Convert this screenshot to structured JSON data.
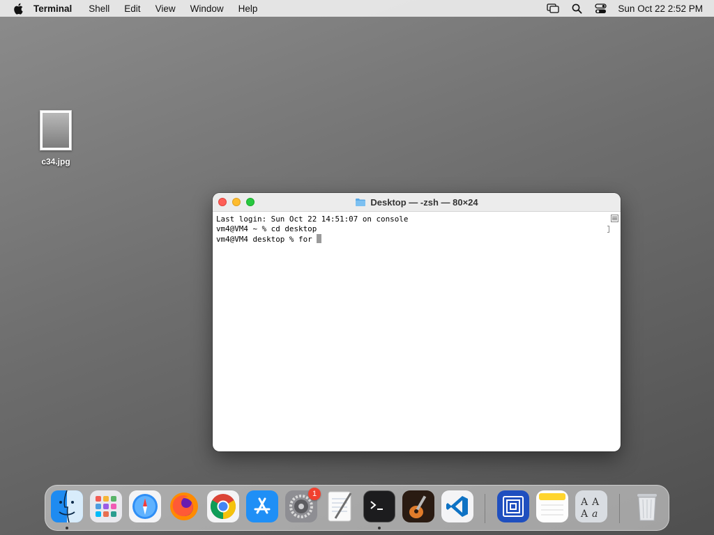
{
  "menubar": {
    "app_name": "Terminal",
    "items": [
      "Shell",
      "Edit",
      "View",
      "Window",
      "Help"
    ],
    "clock": "Sun Oct 22  2:52 PM"
  },
  "desktop": {
    "file_label": "c34.jpg"
  },
  "terminal": {
    "title": "Desktop — -zsh — 80×24",
    "lines": [
      "Last login: Sun Oct 22 14:51:07 on console",
      "vm4@VM4 ~ % cd desktop",
      "vm4@VM4 desktop % for "
    ]
  },
  "dock": {
    "apps": [
      "Finder",
      "Launchpad",
      "Safari",
      "Firefox",
      "Google Chrome",
      "App Store",
      "System Settings",
      "TextEdit",
      "Terminal",
      "GarageBand",
      "Visual Studio Code",
      "Remote Desktop",
      "Notes",
      "Font Book",
      "Trash"
    ],
    "settings_badge": "1"
  },
  "colors": {
    "close": "#fe5f57",
    "minimize": "#febc2e",
    "maximize": "#28c840",
    "badge": "#f0412f"
  }
}
